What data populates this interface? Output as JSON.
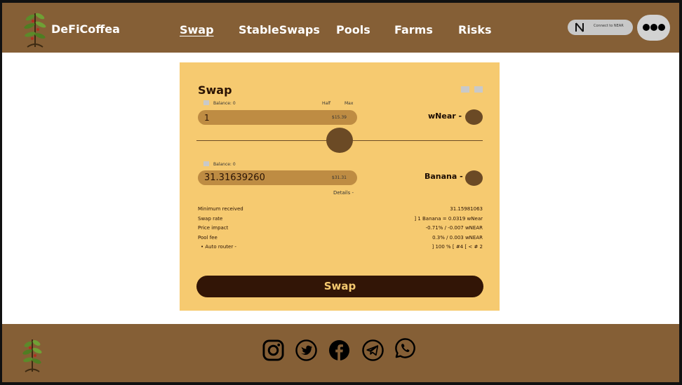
{
  "header": {
    "brand": "DeFiCoffea",
    "nav": [
      {
        "label": "Swap",
        "active": true
      },
      {
        "label": "StableSwaps"
      },
      {
        "label": "Pools"
      },
      {
        "label": "Farms"
      },
      {
        "label": "Risks"
      }
    ],
    "connect_label": "Connect to NEAR",
    "more_icon": "more-dots-icon"
  },
  "swap": {
    "title": "Swap",
    "from": {
      "balance_label": "Balance: 0",
      "half_label": "Half",
      "max_label": "Max",
      "amount": "1",
      "usd_value": "$15.39",
      "token": "wNear -"
    },
    "to": {
      "balance_label": "Balance: 0",
      "amount": "31.31639260",
      "usd_value": "$31.31",
      "token": "Banana -"
    },
    "details_label": "Details -",
    "details": [
      {
        "label": "Minimum received",
        "value": "31.15981063"
      },
      {
        "label": "Swap rate",
        "value": "] 1 Banana = 0.0319 wNear"
      },
      {
        "label": "Price impact",
        "value": "-0.71% / -0.007 wNEAR"
      },
      {
        "label": "Pool fee",
        "value": "0.3% / 0.003 wNEAR"
      },
      {
        "label": "•  Auto router -",
        "value": "] 100 % [ #4 [ < # 2"
      }
    ],
    "submit_label": "Swap"
  },
  "footer": {
    "social_icons": [
      "instagram-icon",
      "twitter-icon",
      "facebook-icon",
      "telegram-icon",
      "whatsapp-icon"
    ]
  },
  "colors": {
    "header_bg": "#855f36",
    "card_bg": "#f6ca70",
    "input_bg": "#be8c43",
    "button_bg": "#321506",
    "token_circle": "#6b4a25"
  }
}
